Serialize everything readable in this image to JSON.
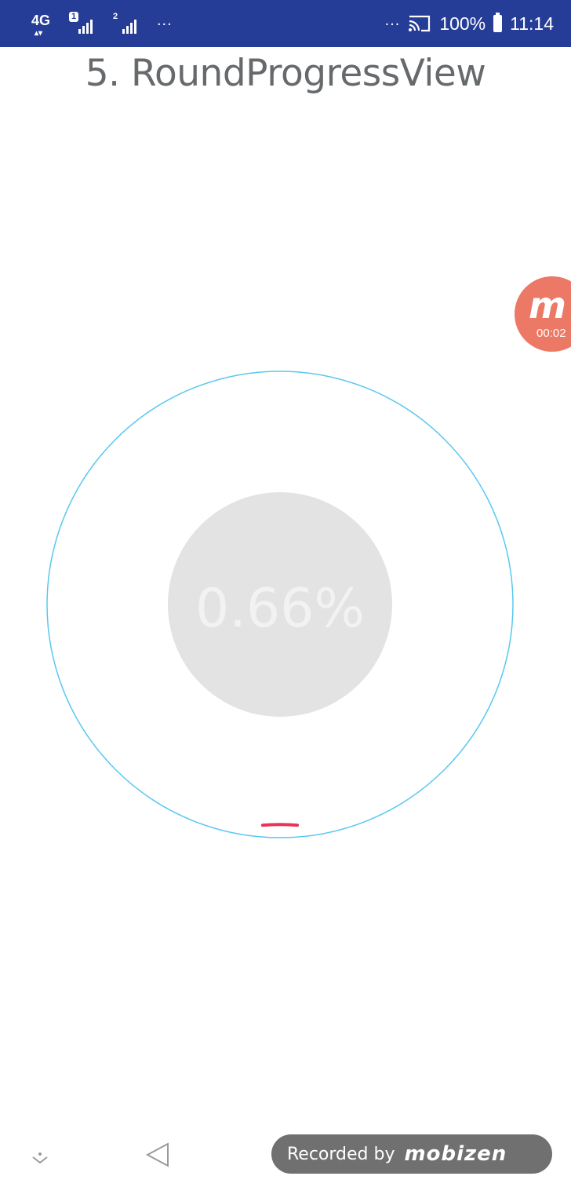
{
  "status_bar": {
    "network_type": "4G",
    "sim1_badge": "1",
    "sim2_badge": "2",
    "left_more": "...",
    "right_more": "...",
    "cast_icon": "cast-icon",
    "battery_percent": "100%",
    "time": "11:14",
    "background_color": "#263d98"
  },
  "page": {
    "title": "5. RoundProgressView"
  },
  "round_progress": {
    "text": "0.66%",
    "progress_percent": 0.66,
    "track_color": "#58c8f0",
    "progress_color": "#e8335a",
    "inner_circle_color": "#e3e3e3",
    "text_color": "#f2f2f2"
  },
  "recorder_bubble": {
    "logo": "m",
    "elapsed": "00:02",
    "color": "#ec7866"
  },
  "nav_bar": {
    "hide_icon": "chevron-down-icon",
    "back_icon": "back-triangle-icon"
  },
  "watermark": {
    "text": "Recorded by",
    "logo": "mobizen"
  }
}
